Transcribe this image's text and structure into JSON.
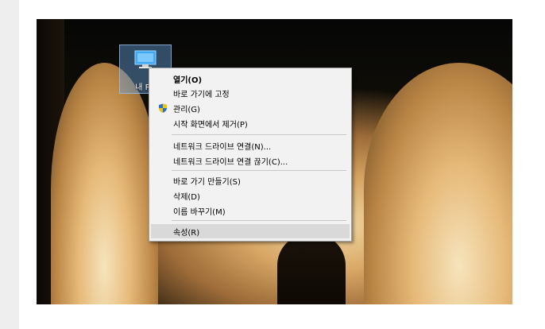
{
  "desktop_icon": {
    "label": "내 PC",
    "icon": "computer-icon"
  },
  "context_menu": {
    "items": [
      {
        "label": "열기(O)",
        "default": true
      },
      {
        "label": "바로 가기에 고정"
      },
      {
        "label": "관리(G)",
        "icon": "shield-icon"
      },
      {
        "label": "시작 화면에서 제거(P)"
      },
      {
        "label": "네트워크 드라이브 연결(N)..."
      },
      {
        "label": "네트워크 드라이브 연결 끊기(C)..."
      },
      {
        "label": "바로 가기 만들기(S)"
      },
      {
        "label": "삭제(D)"
      },
      {
        "label": "이름 바꾸기(M)"
      },
      {
        "label": "속성(R)",
        "highlighted": true
      }
    ]
  },
  "colors": {
    "menu_background": "#f2f2f2",
    "highlight": "#d9d9d9",
    "icon_selection": "#66a0dc"
  }
}
